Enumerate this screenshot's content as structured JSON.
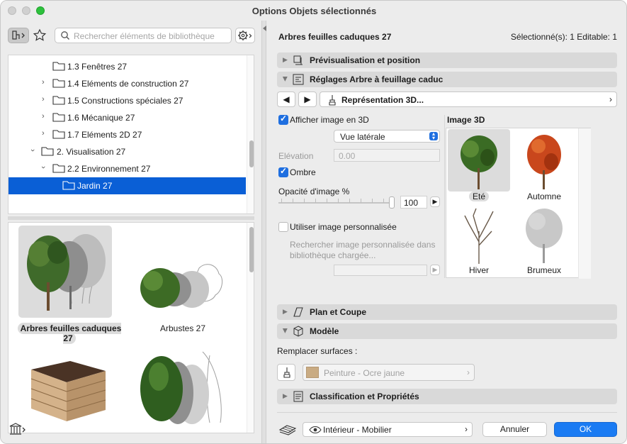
{
  "window": {
    "title": "Options Objets sélectionnés"
  },
  "search": {
    "placeholder": "Rechercher éléments de bibliothèque"
  },
  "tree": [
    {
      "label": "1.3 Fenêtres 27"
    },
    {
      "label": "1.4 Eléments de construction 27"
    },
    {
      "label": "1.5 Constructions spéciales 27"
    },
    {
      "label": "1.6 Mécanique 27"
    },
    {
      "label": "1.7 Eléments 2D 27"
    },
    {
      "label": "2. Visualisation 27"
    },
    {
      "label": "2.2 Environnement 27"
    },
    {
      "label": "Jardin 27"
    }
  ],
  "gallery": [
    {
      "label": "Arbres feuilles caduques 27",
      "icon": "deciduous-trees-icon"
    },
    {
      "label": "Arbustes 27",
      "icon": "shrubs-icon"
    },
    {
      "label": "",
      "icon": "planter-box-icon"
    },
    {
      "label": "",
      "icon": "conifer-icon"
    }
  ],
  "header": {
    "object_name": "Arbres feuilles caduques 27",
    "selection_info": "Sélectionné(s): 1 Editable: 1"
  },
  "sections": {
    "preview": "Prévisualisation et position",
    "settings": "Réglages Arbre à feuillage caduc",
    "plan": "Plan et Coupe",
    "model": "Modèle",
    "classification": "Classification et Propriétés"
  },
  "nav": {
    "page": "Représentation 3D..."
  },
  "settings3d": {
    "show_image_label": "Afficher image en 3D",
    "view_value": "Vue latérale",
    "elevation_label": "Elévation",
    "elevation_value": "0.00",
    "shadow_label": "Ombre",
    "opacity_label": "Opacité d'image %",
    "opacity_value": "100",
    "opacity_level": 1.0,
    "custom_image_label": "Utiliser image personnalisée",
    "custom_image_hint": "Rechercher image personnalisée dans bibliothèque chargée..."
  },
  "image3d": {
    "title": "Image 3D",
    "options": [
      {
        "label": "Eté",
        "selected": true
      },
      {
        "label": "Automne",
        "selected": false
      },
      {
        "label": "Hiver",
        "selected": false
      },
      {
        "label": "Brumeux",
        "selected": false
      }
    ]
  },
  "model": {
    "override_label": "Remplacer surfaces :",
    "surface_value": "Peinture - Ocre jaune",
    "surface_color": "#c9ab83"
  },
  "footer": {
    "layer_value": "Intérieur - Mobilier",
    "cancel_label": "Annuler",
    "ok_label": "OK"
  },
  "colors": {
    "accent": "#1a7bf3",
    "selection": "#0a5fd6"
  }
}
